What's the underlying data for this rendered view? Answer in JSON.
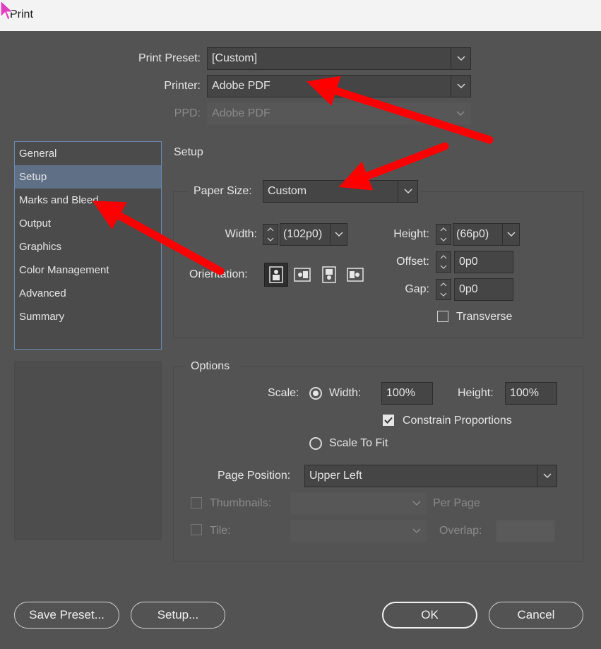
{
  "window": {
    "title": "Print"
  },
  "top": {
    "print_preset": {
      "label": "Print Preset:",
      "value": "[Custom]"
    },
    "printer": {
      "label": "Printer:",
      "value": "Adobe PDF"
    },
    "ppd": {
      "label": "PPD:",
      "value": "Adobe PDF"
    }
  },
  "sidebar": {
    "items": [
      {
        "label": "General"
      },
      {
        "label": "Setup"
      },
      {
        "label": "Marks and Bleed"
      },
      {
        "label": "Output"
      },
      {
        "label": "Graphics"
      },
      {
        "label": "Color Management"
      },
      {
        "label": "Advanced"
      },
      {
        "label": "Summary"
      }
    ],
    "selected": "Setup"
  },
  "setup": {
    "title": "Setup",
    "paper_size": {
      "label": "Paper Size:",
      "value": "Custom"
    },
    "width": {
      "label": "Width:",
      "value": "(102p0)"
    },
    "height": {
      "label": "Height:",
      "value": "(66p0)"
    },
    "offset": {
      "label": "Offset:",
      "value": "0p0"
    },
    "gap": {
      "label": "Gap:",
      "value": "0p0"
    },
    "orientation": {
      "label": "Orientation:"
    },
    "transverse": {
      "label": "Transverse",
      "checked": false
    }
  },
  "options": {
    "title": "Options",
    "scale": {
      "label": "Scale:"
    },
    "scale_width": {
      "label": "Width:",
      "value": "100%",
      "selected": true
    },
    "scale_height": {
      "label": "Height:",
      "value": "100%"
    },
    "constrain": {
      "label": "Constrain Proportions",
      "checked": true
    },
    "scale_to_fit": {
      "label": "Scale To Fit",
      "selected": false
    },
    "page_position": {
      "label": "Page Position:",
      "value": "Upper Left"
    },
    "thumbnails": {
      "label": "Thumbnails:",
      "per_page": "Per Page",
      "value": ""
    },
    "tile": {
      "label": "Tile:",
      "overlap_label": "Overlap:",
      "value": ""
    }
  },
  "buttons": {
    "save_preset": "Save Preset...",
    "setup": "Setup...",
    "ok": "OK",
    "cancel": "Cancel"
  },
  "colors": {
    "background": "#535353",
    "annotation_arrow": "#ff0000",
    "cursor": "#e040c0"
  }
}
